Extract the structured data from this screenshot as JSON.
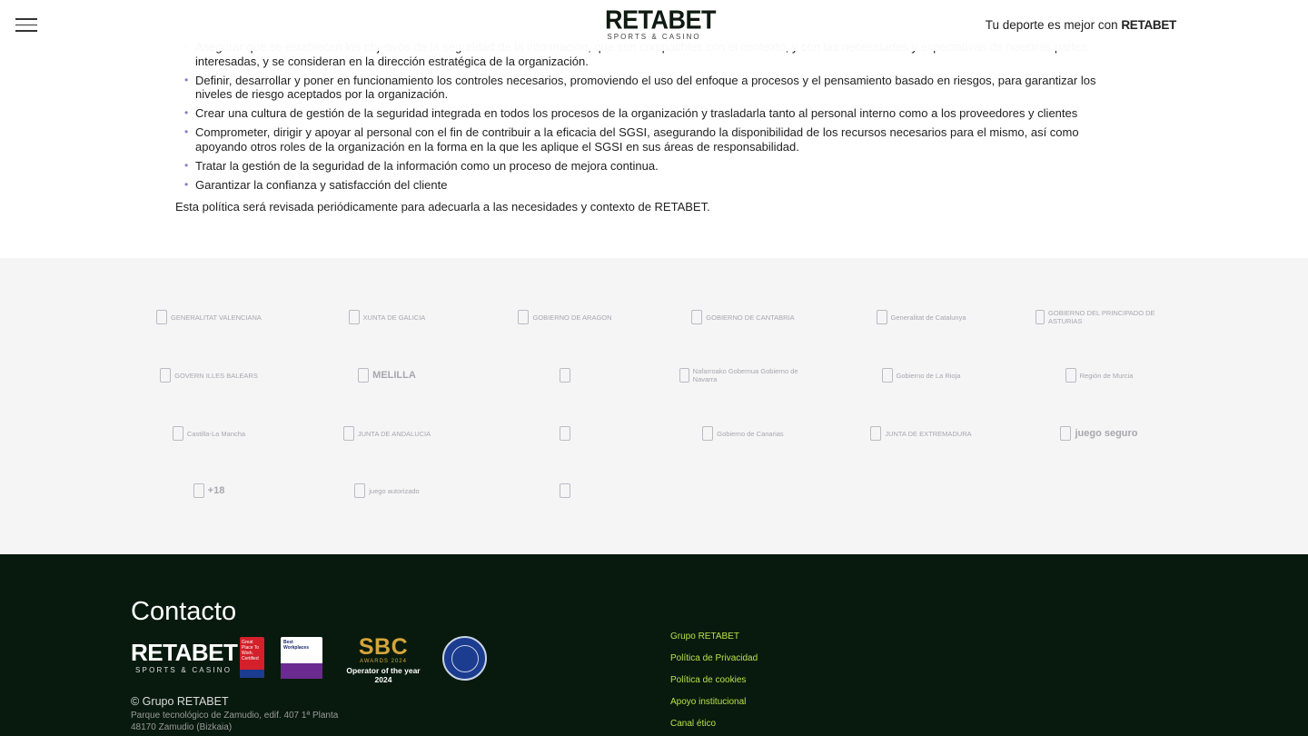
{
  "header": {
    "logo_main": "RETABET",
    "logo_sub": "SPORTS & CASINO",
    "tagline_prefix": "Tu deporte es mejor con ",
    "tagline_brand": "RETABET"
  },
  "policy": {
    "items": [
      "Asegurar que se establecen los objetivos de la seguridad de la información, que son compatibles con el contexto, y con las necesidades y expectativas de nuestras partes interesadas, y se consideran en la dirección estratégica de la organización.",
      "Definir, desarrollar y poner en funcionamiento los controles necesarios, promoviendo el uso del enfoque a procesos y el pensamiento basado en riesgos, para garantizar los niveles de riesgo aceptados por la organización.",
      "Crear una cultura de gestión de la seguridad integrada en todos los procesos de la organización y trasladarla tanto al personal interno como a los proveedores y clientes",
      "Comprometer, dirigir y apoyar al personal con el fin de contribuir a la eficacia del SGSI, asegurando la disponibilidad de los recursos necesarios para el mismo, así como apoyando otros roles de la organización en la forma en la que les aplique el SGSI en sus áreas de responsabilidad.",
      "Tratar la gestión de la seguridad de la información como un proceso de mejora continua.",
      "Garantizar la confianza y satisfacción del cliente"
    ],
    "closing": "Esta política será revisada periódicamente para adecuarla a las necesidades y contexto de RETABET."
  },
  "institution_logos": [
    {
      "name": "generalitat-valenciana-logo",
      "text": "GENERALITAT VALENCIANA"
    },
    {
      "name": "xunta-de-galicia-logo",
      "text": "XUNTA DE GALICIA"
    },
    {
      "name": "gobierno-de-aragon-logo",
      "text": "GOBIERNO DE ARAGON"
    },
    {
      "name": "gobierno-de-cantabria-logo",
      "text": "GOBIERNO DE CANTABRIA"
    },
    {
      "name": "generalitat-de-catalunya-logo",
      "text": "Generalitat de Catalunya"
    },
    {
      "name": "gobierno-del-principado-de-asturias-logo",
      "text": "GOBIERNO DEL PRINCIPADO DE ASTURIAS"
    },
    {
      "name": "gobierno-illes-balears-logo",
      "text": "GOVERN ILLES BALEARS"
    },
    {
      "name": "ciudad-autonoma-melilla-logo",
      "text": "MELILLA"
    },
    {
      "name": "ceuta-logo",
      "text": ""
    },
    {
      "name": "gobierno-de-navarra-logo",
      "text": "Nafarroako Gobernua Gobierno de Navarra"
    },
    {
      "name": "gobierno-de-la-rioja-logo",
      "text": "Gobierno de La Rioja"
    },
    {
      "name": "region-de-murcia-logo",
      "text": "Región de Murcia"
    },
    {
      "name": "castilla-la-mancha-logo",
      "text": "Castilla-La Mancha"
    },
    {
      "name": "junta-de-andalucia-logo",
      "text": "JUNTA DE ANDALUCIA"
    },
    {
      "name": "comunidad-de-madrid-logo",
      "text": ""
    },
    {
      "name": "gobierno-de-canarias-logo",
      "text": "Gobierno de Canarias"
    },
    {
      "name": "junta-de-extremadura-logo",
      "text": "JUNTA DE EXTREMADURA"
    },
    {
      "name": "juego-seguro-logo",
      "text": "juego seguro"
    },
    {
      "name": "plus-18-logo",
      "text": "+18"
    },
    {
      "name": "juego-autorizado-logo",
      "text": "juego autorizado"
    },
    {
      "name": "autoprohibicion-logo",
      "text": ""
    }
  ],
  "footer": {
    "title": "Contacto",
    "logo_main": "RETABET",
    "logo_sub": "SPORTS & CASINO",
    "gptw": "Great Place To Work. Certified",
    "bw": "Best Workplaces",
    "sbc_main": "SBC",
    "sbc_awards": "AWARDS 2024",
    "sbc_operator": "Operator of the year 2024",
    "copyright": "© Grupo RETABET",
    "address_line1": "Parque tecnológico de Zamudio, edif. 407 1ª Planta",
    "address_line2": "48170 Zamudio (Bizkaia)",
    "links": [
      "Grupo RETABET",
      "Política de Privacidad",
      "Política de cookies",
      "Apoyo institucional",
      "Canal ético"
    ]
  }
}
